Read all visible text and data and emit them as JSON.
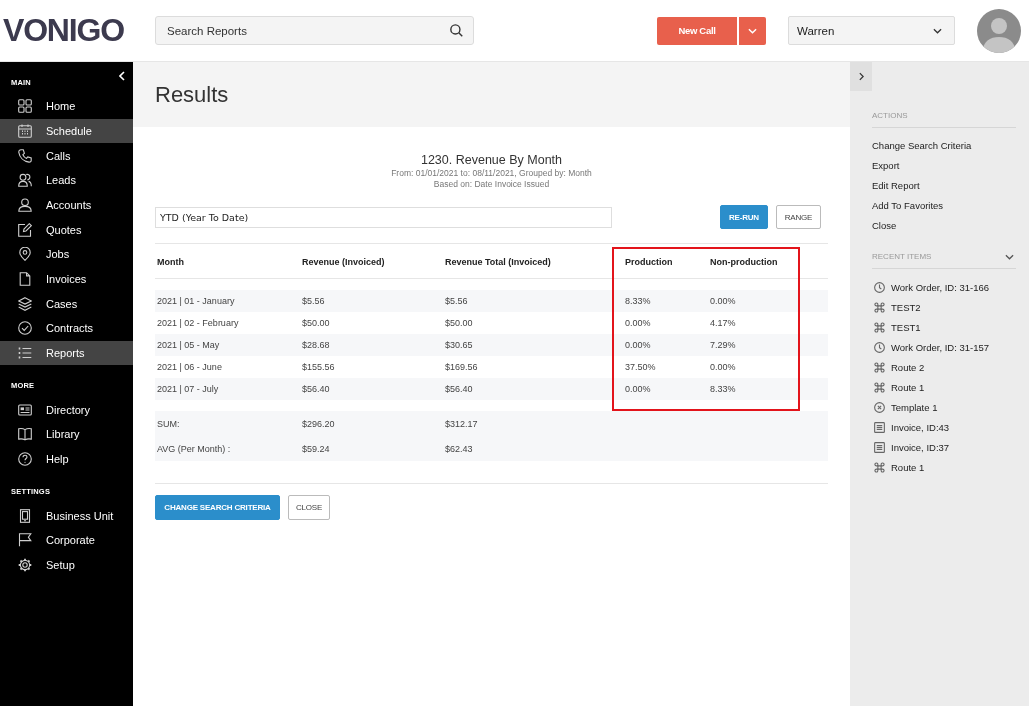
{
  "header": {
    "logo": "VONIGO",
    "search": {
      "placeholder": "Search Reports"
    },
    "new_call_button": "New Call",
    "user_menu": {
      "value": "Warren"
    }
  },
  "sidebar": {
    "sections": [
      {
        "title": "MAIN",
        "items": [
          {
            "label": "Home",
            "selected": false
          },
          {
            "label": "Schedule",
            "selected": true
          },
          {
            "label": "Calls",
            "selected": false
          },
          {
            "label": "Leads",
            "selected": false
          },
          {
            "label": "Accounts",
            "selected": false
          },
          {
            "label": "Quotes",
            "selected": false
          },
          {
            "label": "Jobs",
            "selected": false
          },
          {
            "label": "Invoices",
            "selected": false
          },
          {
            "label": "Cases",
            "selected": false
          },
          {
            "label": "Contracts",
            "selected": false
          },
          {
            "label": "Reports",
            "selected": true
          }
        ]
      },
      {
        "title": "MORE",
        "items": [
          {
            "label": "Directory",
            "selected": false
          },
          {
            "label": "Library",
            "selected": false
          },
          {
            "label": "Help",
            "selected": false
          }
        ]
      },
      {
        "title": "SETTINGS",
        "items": [
          {
            "label": "Business Unit",
            "selected": false
          },
          {
            "label": "Corporate",
            "selected": false
          },
          {
            "label": "Setup",
            "selected": false
          }
        ]
      }
    ]
  },
  "page_title": "Results",
  "report": {
    "title": "1230. Revenue By Month",
    "subtitle_lines": [
      "From: 01/01/2021 to: 08/11/2021, Grouped by: Month",
      "Based on: Date Invoice Issued"
    ],
    "range_field": {
      "value": "YTD (Year To Date)"
    },
    "buttons": [
      {
        "label": "RE-RUN",
        "kind": "primary"
      },
      {
        "label": "RANGE",
        "kind": "secondary"
      }
    ],
    "table": {
      "columns": [
        {
          "label": "Month",
          "highlighted": false
        },
        {
          "label": "Revenue (Invoiced)",
          "highlighted": false
        },
        {
          "label": "Revenue Total (Invoiced)",
          "highlighted": false
        },
        {
          "label": "Production",
          "highlighted": true
        },
        {
          "label": "Non-production",
          "highlighted": true
        }
      ],
      "rows": [
        [
          "2021 | 01 - January",
          "$5.56",
          "$5.56",
          "8.33%",
          "0.00%"
        ],
        [
          "2021 | 02 - February",
          "$50.00",
          "$50.00",
          "0.00%",
          "4.17%"
        ],
        [
          "2021 | 05 - May",
          "$28.68",
          "$30.65",
          "0.00%",
          "7.29%"
        ],
        [
          "2021 | 06 - June",
          "$155.56",
          "$169.56",
          "37.50%",
          "0.00%"
        ],
        [
          "2021 | 07 - July",
          "$56.40",
          "$56.40",
          "0.00%",
          "8.33%"
        ]
      ],
      "summary_rows": [
        [
          "SUM:",
          "$296.20",
          "$312.17"
        ],
        [
          "AVG (Per Month) :",
          "$59.24",
          "$62.43"
        ]
      ]
    },
    "footer_buttons": [
      {
        "label": "CHANGE SEARCH CRITERIA",
        "kind": "primary"
      },
      {
        "label": "CLOSE",
        "kind": "secondary"
      }
    ]
  },
  "right_panel": {
    "actions": {
      "title": "ACTIONS",
      "items": [
        "Change Search Criteria",
        "Export",
        "Edit Report",
        "Add To Favorites",
        "Close"
      ]
    },
    "recent_items": {
      "title": "RECENT ITEMS",
      "expanded": true,
      "items": [
        {
          "label": "Work Order, ID: 31-166",
          "kind": "workorder"
        },
        {
          "label": "TEST2",
          "kind": "route"
        },
        {
          "label": "TEST1",
          "kind": "route"
        },
        {
          "label": "Work Order, ID: 31-157",
          "kind": "workorder"
        },
        {
          "label": "Route 2",
          "kind": "route"
        },
        {
          "label": "Route 1",
          "kind": "route"
        },
        {
          "label": "Template 1",
          "kind": "template"
        },
        {
          "label": "Invoice, ID:43",
          "kind": "invoice"
        },
        {
          "label": "Invoice, ID:37",
          "kind": "invoice"
        },
        {
          "label": "Route 1",
          "kind": "route"
        }
      ]
    }
  }
}
